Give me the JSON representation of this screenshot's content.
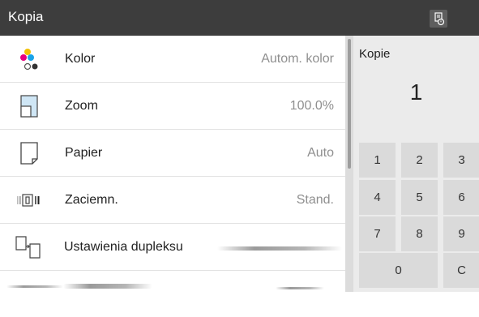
{
  "header": {
    "title": "Kopia",
    "job_icon": "job-list-icon"
  },
  "settings": [
    {
      "icon": "color-dots-icon",
      "label": "Kolor",
      "value": "Autom. kolor"
    },
    {
      "icon": "zoom-page-icon",
      "label": "Zoom",
      "value": "100.0%"
    },
    {
      "icon": "paper-icon",
      "label": "Papier",
      "value": "Auto"
    },
    {
      "icon": "density-icon",
      "label": "Zaciemn.",
      "value": "Stand."
    },
    {
      "icon": "duplex-icon",
      "label": "Ustawienia dupleksu",
      "value": ""
    }
  ],
  "copies": {
    "label": "Kopie",
    "count": "1"
  },
  "keypad": {
    "k1": "1",
    "k2": "2",
    "k3": "3",
    "k4": "4",
    "k5": "5",
    "k6": "6",
    "k7": "7",
    "k8": "8",
    "k9": "9",
    "k0": "0",
    "clear": "C"
  },
  "colors": {
    "header": "#3d3d3d",
    "panel": "#ebebeb",
    "key": "#dadada"
  }
}
